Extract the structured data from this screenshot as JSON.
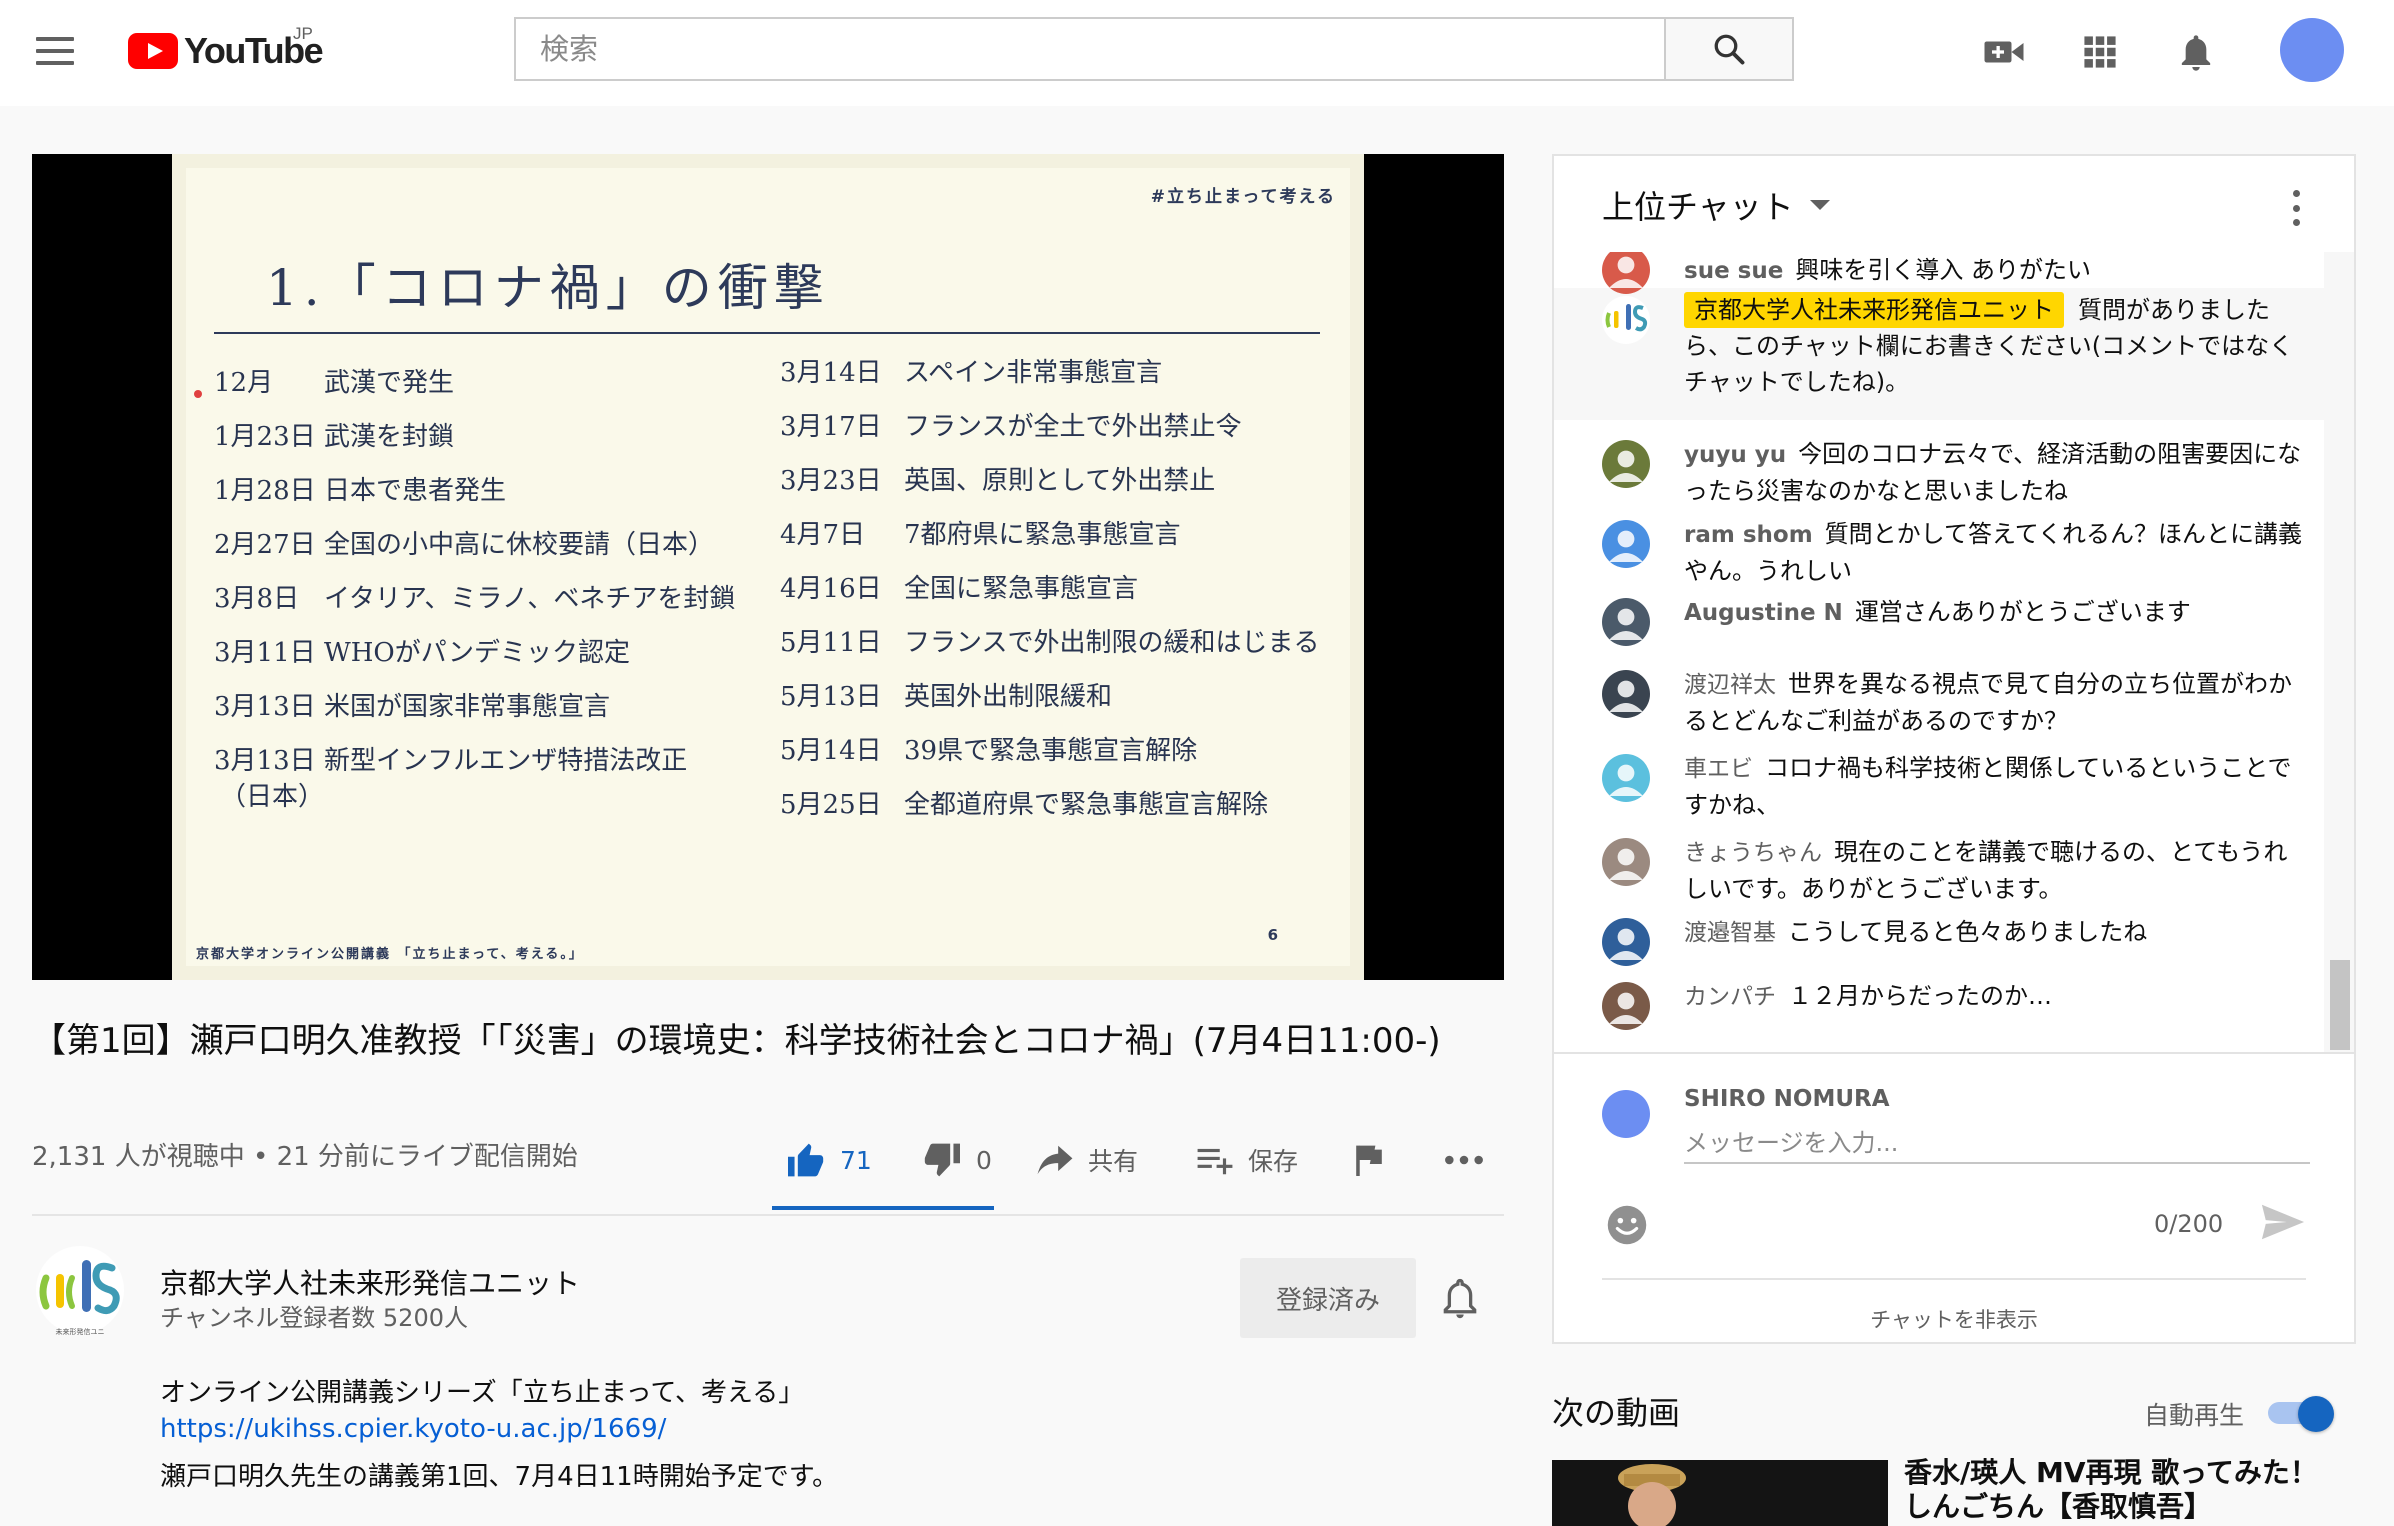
{
  "header": {
    "logo_text": "YouTube",
    "region": "JP",
    "search_placeholder": "検索",
    "avatar_color": "#6c8ef2"
  },
  "icons": {
    "menu": "menu-icon",
    "search": "search-icon",
    "create": "video-camera-plus-icon",
    "apps": "apps-grid-icon",
    "notifications": "bell-icon"
  },
  "slide": {
    "tag": "#立ち止まって考える",
    "title": "1.「コロナ禍」の衝撃",
    "left_events": [
      {
        "date": "12月",
        "text": "武漢で発生"
      },
      {
        "date": "1月23日",
        "text": "武漢を封鎖"
      },
      {
        "date": "1月28日",
        "text": "日本で患者発生"
      },
      {
        "date": "2月27日",
        "text": "全国の小中高に休校要請（日本）"
      },
      {
        "date": "3月8日",
        "text": "イタリア、ミラノ、ベネチアを封鎖"
      },
      {
        "date": "3月11日",
        "text": "WHOがパンデミック認定"
      },
      {
        "date": "3月13日",
        "text": "米国が国家非常事態宣言"
      },
      {
        "date": "3月13日",
        "text": "新型インフルエンザ特措法改正"
      }
    ],
    "left_extra": "（日本）",
    "right_events": [
      {
        "date": "3月14日",
        "text": "スペイン非常事態宣言"
      },
      {
        "date": "3月17日",
        "text": "フランスが全土で外出禁止令"
      },
      {
        "date": "3月23日",
        "text": "英国、原則として外出禁止"
      },
      {
        "date": "4月7日",
        "text": "7都府県に緊急事態宣言"
      },
      {
        "date": "4月16日",
        "text": "全国に緊急事態宣言"
      },
      {
        "date": "5月11日",
        "text": "フランスで外出制限の緩和はじまる"
      },
      {
        "date": "5月13日",
        "text": "英国外出制限緩和"
      },
      {
        "date": "5月14日",
        "text": "39県で緊急事態宣言解除"
      },
      {
        "date": "5月25日",
        "text": "全都道府県で緊急事態宣言解除"
      }
    ],
    "footer": "京都大学オンライン公開講義 「立ち止まって、考える。」",
    "page_number": "6"
  },
  "video": {
    "title": "【第1回】瀬戸口明久准教授「「災害」の環境史：科学技術社会とコロナ禍」(7月4日11:00-)",
    "view_info": "2,131 人が視聴中 • 21 分前にライブ配信開始",
    "like_count": "71",
    "dislike_count": "0",
    "share_label": "共有",
    "save_label": "保存",
    "accent_color": "#1565c0"
  },
  "channel": {
    "name": "京都大学人社未来形発信ユニット",
    "subscribers": "チャンネル登録者数 5200人",
    "logo_caption": "未来形発信ユニ",
    "subscribed_label": "登録済み"
  },
  "description": {
    "line1": "オンライン公開講義シリーズ「立ち止まって、考える」",
    "link": "https://ukihss.cpier.kyoto-u.ac.jp/1669/",
    "line3": "瀬戸口明久先生の講義第1回、7月4日11時開始予定です。"
  },
  "chat": {
    "mode_label": "上位チャット",
    "messages": [
      {
        "author": "sue sue",
        "text": "興味を引く導入 ありがたい",
        "avatar_color": "#d85a4a"
      },
      {
        "author": "京都大学人社未来形発信ユニット",
        "text": "質問がありましたら、このチャット欄にお書きください(コメントではなくチャットでしたね)。",
        "avatar_color": "#ffffff"
      },
      {
        "author": "yuyu yu",
        "text": "今回のコロナ云々で、経済活動の阻害要因になったら災害なのかなと思いましたね",
        "avatar_color": "#6b7a3a"
      },
      {
        "author": "ram shom",
        "text": "質問とかして答えてくれるん？ほんとに講義やん。うれしい",
        "avatar_color": "#4a90e2"
      },
      {
        "author": "Augustine N",
        "text": "運営さんありがとうございます",
        "avatar_color": "#4b5a6a"
      },
      {
        "author": "渡辺祥太",
        "text": "世界を異なる視点で見て自分の立ち位置がわかるとどんなご利益があるのですか？",
        "avatar_color": "#3a4450"
      },
      {
        "author": "車エビ",
        "text": "コロナ禍も科学技術と関係しているということですかね、",
        "avatar_color": "#5bc0de"
      },
      {
        "author": "きょうちゃん",
        "text": "現在のことを講義で聴けるの、とてもうれしいです。ありがとうございます。",
        "avatar_color": "#9b8a80"
      },
      {
        "author": "渡邉智基",
        "text": "こうして見ると色々ありましたね",
        "avatar_color": "#2f5f9a"
      },
      {
        "author": "カンパチ",
        "text": "１２月からだったのか…",
        "avatar_color": "#7a5a48"
      }
    ],
    "me_name": "SHIRO NOMURA",
    "input_placeholder": "メッセージを入力...",
    "char_count": "0/200",
    "hide_label": "チャットを非表示",
    "owner_badge_color": "#ffd600"
  },
  "up_next": {
    "title": "次の動画",
    "autoplay_label": "自動再生",
    "autoplay_on": true,
    "next_video_title": "香水/瑛人 MV再現 歌ってみた！しんごちん【香取慎吾】"
  }
}
